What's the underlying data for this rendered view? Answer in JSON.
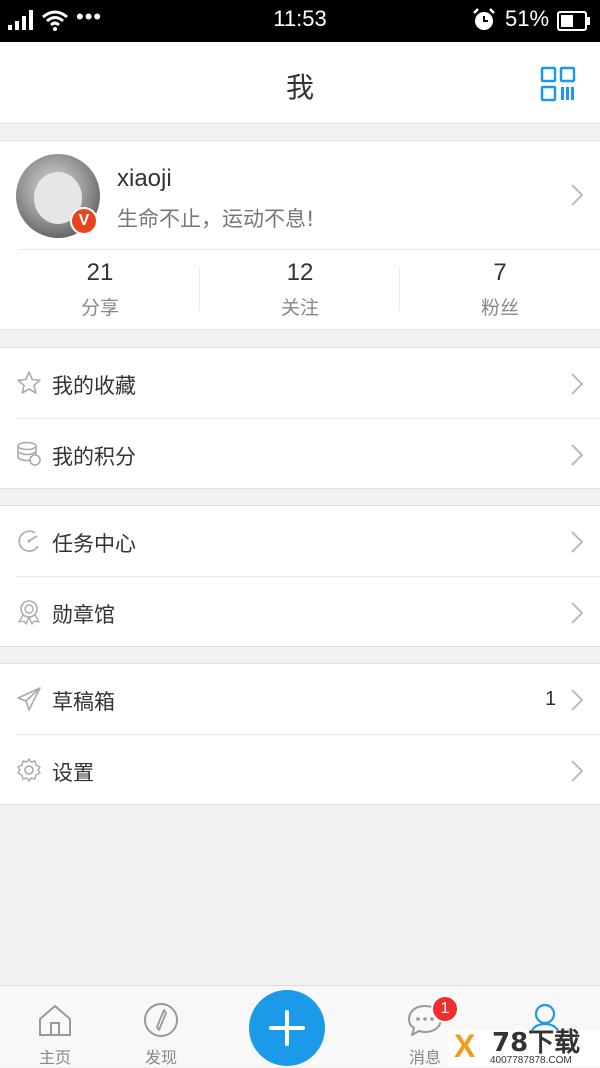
{
  "status_bar": {
    "time": "11:53",
    "dots": "•••",
    "battery_percent": "51%"
  },
  "header": {
    "title": "我"
  },
  "profile": {
    "username": "xiaoji",
    "signature": "生命不止，运动不息!",
    "badge": "V",
    "stats": [
      {
        "value": "21",
        "label": "分享"
      },
      {
        "value": "12",
        "label": "关注"
      },
      {
        "value": "7",
        "label": "粉丝"
      }
    ]
  },
  "menu": {
    "favorites": "我的收藏",
    "points": "我的积分",
    "tasks": "任务中心",
    "badges": "勋章馆",
    "drafts": "草稿箱",
    "drafts_count": "1",
    "settings": "设置"
  },
  "tabbar": {
    "home": "主页",
    "discover": "发现",
    "messages": "消息",
    "messages_badge": "1"
  },
  "watermark": {
    "logo": "X",
    "title": "78下载",
    "url": "4007787878.COM"
  },
  "colors": {
    "accent": "#1a9ae8",
    "badge_red": "#f22d2d",
    "vip_badge": "#e8441e"
  }
}
